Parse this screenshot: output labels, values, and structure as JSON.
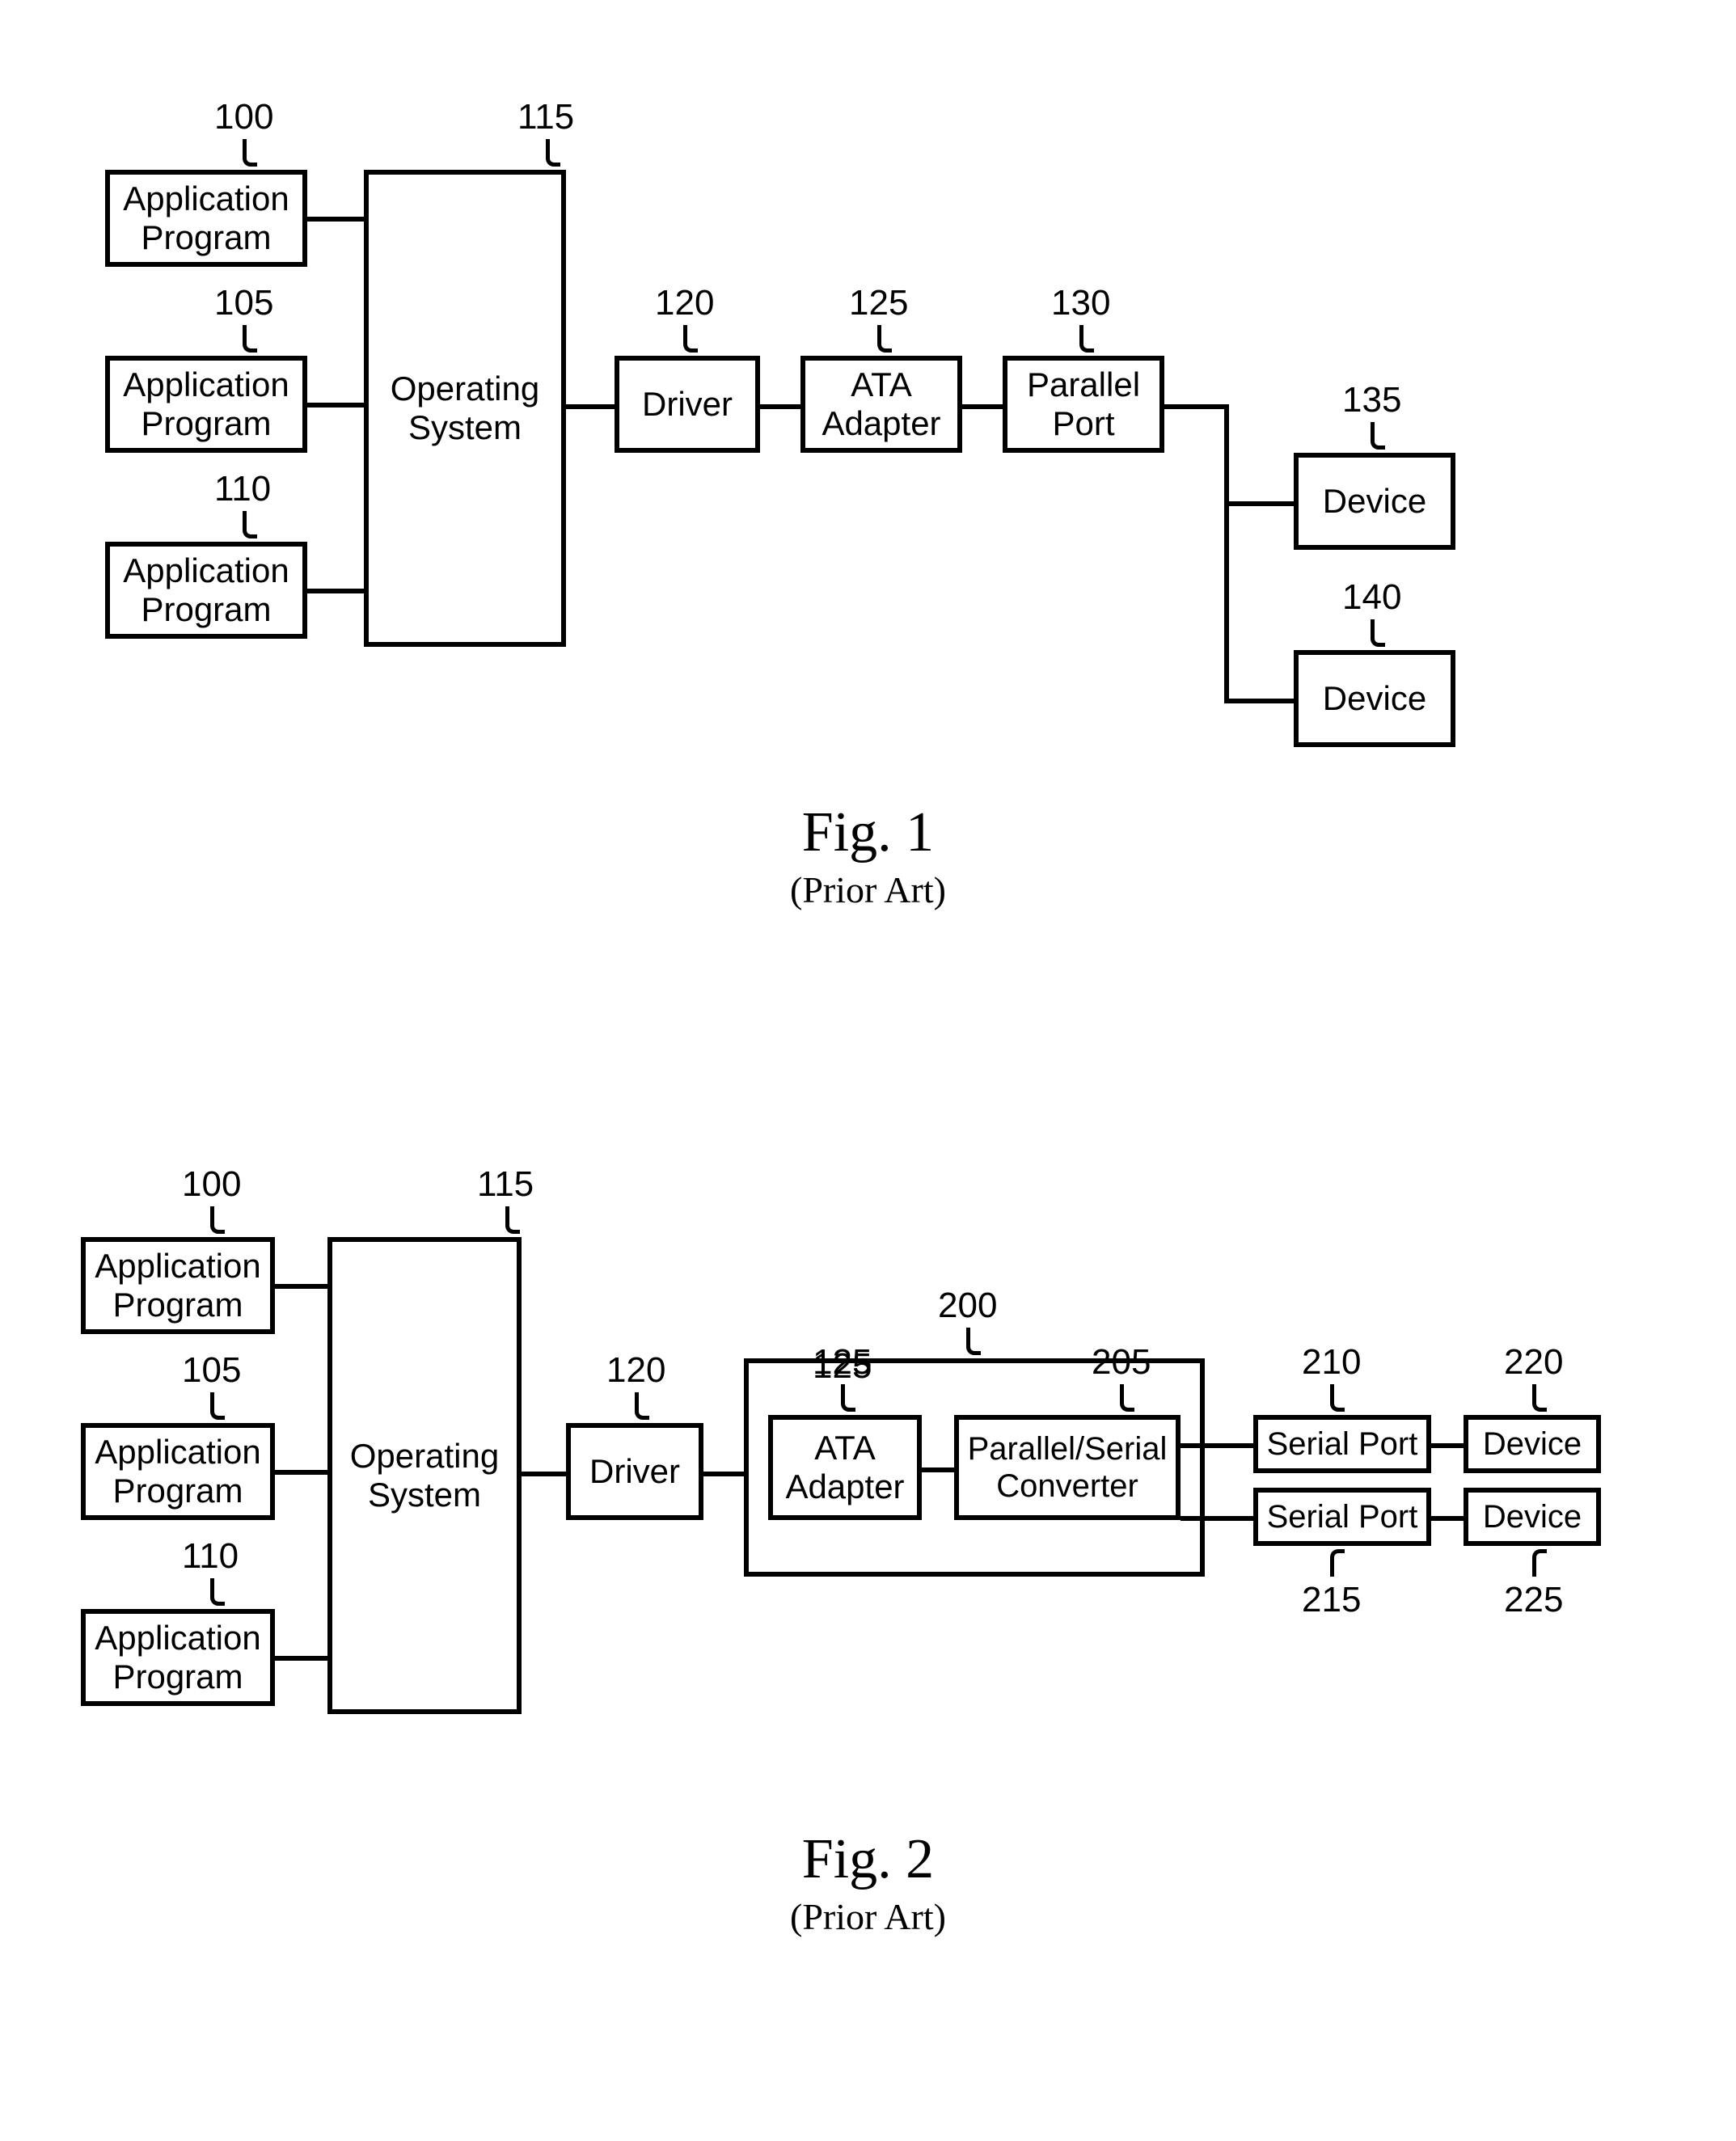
{
  "fig1": {
    "caption": "Fig. 1",
    "subcaption": "(Prior Art)",
    "refs": {
      "app1": "100",
      "app2": "105",
      "app3": "110",
      "os": "115",
      "driver": "120",
      "ata": "125",
      "pport": "130",
      "dev1": "135",
      "dev2": "140"
    },
    "labels": {
      "app": "Application\nProgram",
      "os": "Operating\nSystem",
      "driver": "Driver",
      "ata": "ATA\nAdapter",
      "pport": "Parallel\nPort",
      "device": "Device"
    }
  },
  "fig2": {
    "caption": "Fig. 2",
    "subcaption": "(Prior Art)",
    "refs": {
      "app1": "100",
      "app2": "105",
      "app3": "110",
      "os": "115",
      "driver": "120",
      "ata": "125",
      "container": "200",
      "psconv": "205",
      "sport1": "210",
      "sport2": "215",
      "dev1": "220",
      "dev2": "225"
    },
    "labels": {
      "app": "Application\nProgram",
      "os": "Operating\nSystem",
      "driver": "Driver",
      "ata": "ATA\nAdapter",
      "psconv": "Parallel/Serial\nConverter",
      "sport": "Serial Port",
      "device": "Device"
    }
  }
}
